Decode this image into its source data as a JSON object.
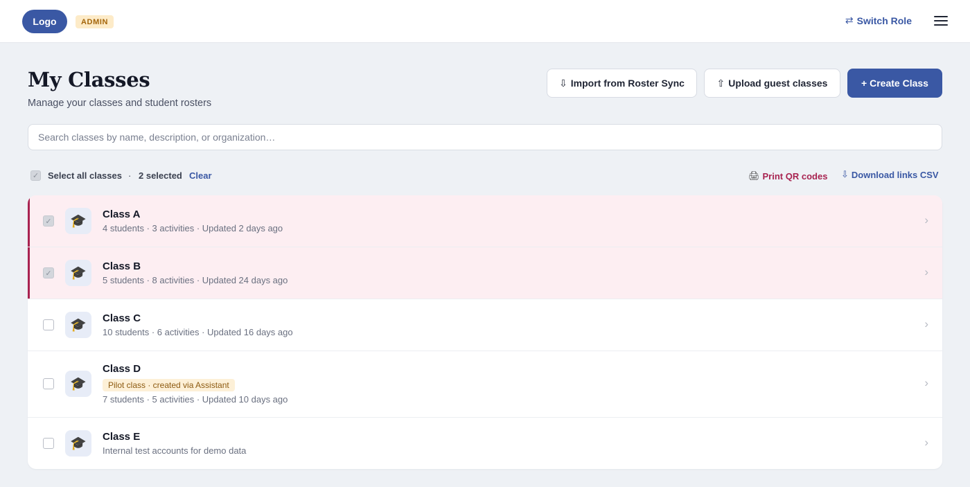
{
  "header": {
    "logo": "Logo",
    "role_badge": "ADMIN",
    "switch_role": "Switch Role",
    "switch_icon": "swap-arrows-icon",
    "menu_icon": "hamburger-menu-icon"
  },
  "page": {
    "title": "My Classes",
    "subtitle": "Manage your classes and student rosters"
  },
  "actions": {
    "import_label": "Import from Roster Sync",
    "upload_label": "Upload guest classes",
    "create_label": "+ Create Class"
  },
  "search": {
    "placeholder": "Search classes by name, description, or organization…",
    "value": ""
  },
  "selection": {
    "select_all_label": "Select all classes",
    "separator": "·",
    "selected_count": "2 selected",
    "clear_label": "Clear",
    "print_qr_label": "Print QR codes",
    "download_csv_label": "Download links CSV"
  },
  "classes": [
    {
      "name": "Class A",
      "meta": "4 students · 3 activities · Updated 2 days ago",
      "selected": true,
      "icon": "graduation-cap-icon"
    },
    {
      "name": "Class B",
      "meta": "5 students · 8 activities · Updated 24 days ago",
      "selected": true,
      "icon": "graduation-cap-icon"
    },
    {
      "name": "Class C",
      "meta": "10 students · 6 activities · Updated 16 days ago",
      "selected": false,
      "icon": "graduation-cap-icon"
    },
    {
      "name": "Class D",
      "badge": "Pilot class · created via Assistant",
      "meta": "7 students · 5 activities · Updated 10 days ago",
      "selected": false,
      "icon": "graduation-cap-icon"
    },
    {
      "name": "Class E",
      "meta": "Internal test accounts for demo data",
      "selected": false,
      "icon": "graduation-cap-icon"
    }
  ],
  "colors": {
    "primary": "#3a58a4",
    "accent": "#a82350",
    "selected_row_bg": "#fdeef2",
    "badge_bg": "#fdebc8"
  }
}
